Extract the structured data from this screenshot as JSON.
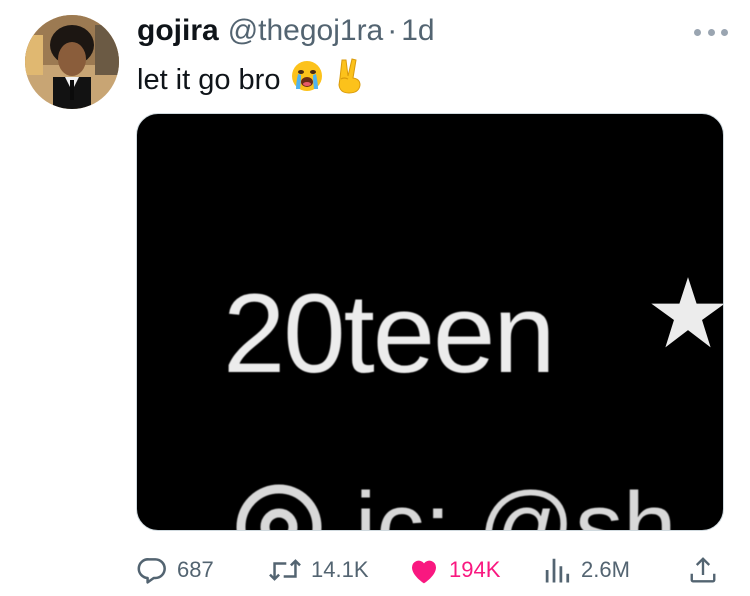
{
  "tweet": {
    "display_name": "gojira",
    "handle": "@thegoj1ra",
    "separator": "·",
    "time": "1d",
    "text": "let it go bro",
    "emojis": [
      "loudly-crying-face-emoji",
      "victory-hand-emoji"
    ]
  },
  "media": {
    "main_text": "20teen",
    "bottom_text": "ic: @sh",
    "icons": [
      "star-icon",
      "instagram-icon"
    ]
  },
  "actions": {
    "replies": "687",
    "retweets": "14.1K",
    "likes": "194K",
    "views": "2.6M"
  },
  "colors": {
    "like_active": "#f91880",
    "text_secondary": "#536471"
  }
}
